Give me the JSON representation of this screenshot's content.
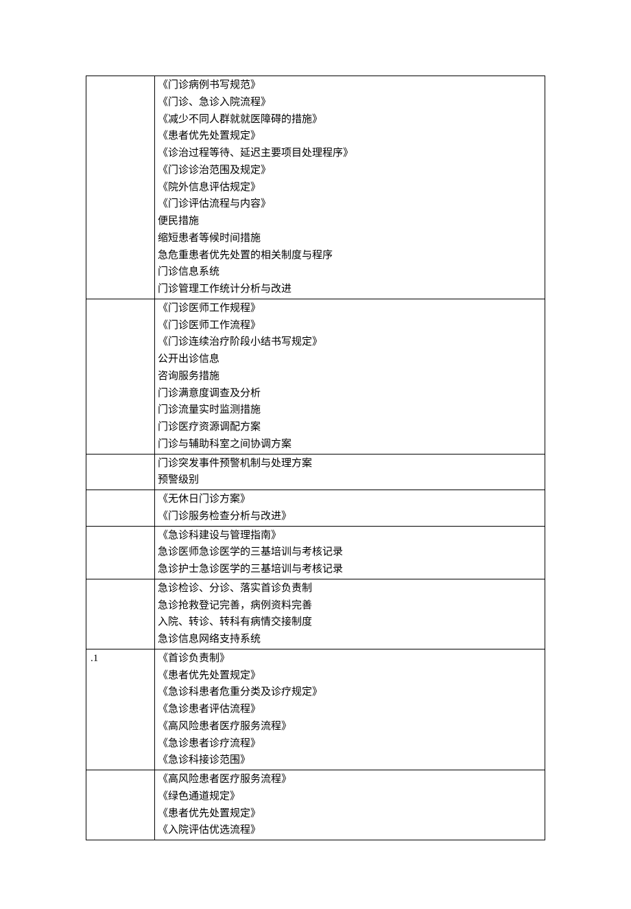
{
  "rows": [
    {
      "col1": "",
      "items": [
        "《门诊病例书写规范》",
        "《门诊、急诊入院流程》",
        "《减少不同人群就就医障碍的措施》",
        "《患者优先处置规定》",
        "《诊治过程等待、延迟主要项目处理程序》",
        "《门诊诊治范围及规定》",
        "《院外信息评估规定》",
        "《门诊评估流程与内容》",
        "便民措施",
        "缩短患者等候时间措施",
        "急危重患者优先处置的相关制度与程序",
        "门诊信息系统",
        "门诊管理工作统计分析与改进"
      ]
    },
    {
      "col1": "",
      "items": [
        "《门诊医师工作规程》",
        "《门诊医师工作流程》",
        "《门诊连续治疗阶段小结书写规定》",
        "公开出诊信息",
        "咨询服务措施",
        "门诊满意度调查及分析",
        "门诊流量实时监测措施",
        "门诊医疗资源调配方案",
        "门诊与辅助科室之间协调方案"
      ]
    },
    {
      "col1": "",
      "items": [
        "门诊突发事件预警机制与处理方案",
        "预警级别"
      ]
    },
    {
      "col1": "",
      "items": [
        "《无休日门诊方案》",
        "《门诊服务检查分析与改进》"
      ]
    },
    {
      "col1": "",
      "items": [
        "《急诊科建设与管理指南》",
        "急诊医师急诊医学的三基培训与考核记录",
        "急诊护士急诊医学的三基培训与考核记录"
      ]
    },
    {
      "col1": "",
      "items": [
        "急诊检诊、分诊、落实首诊负责制",
        "急诊抢救登记完善，病例资料完善",
        "入院、转诊、转科有病情交接制度",
        "急诊信息网络支持系统"
      ]
    },
    {
      "col1": ".1",
      "items": [
        "《首诊负责制》",
        "《患者优先处置规定》",
        "《急诊科患者危重分类及诊疗规定》",
        "《急诊患者评估流程》",
        "《高风险患者医疗服务流程》",
        "《急诊患者诊疗流程》",
        "《急诊科接诊范围》"
      ]
    },
    {
      "col1": "",
      "items": [
        "《高风险患者医疗服务流程》",
        "《绿色通道规定》",
        "《患者优先处置规定》",
        "《入院评估优选流程》"
      ]
    }
  ]
}
